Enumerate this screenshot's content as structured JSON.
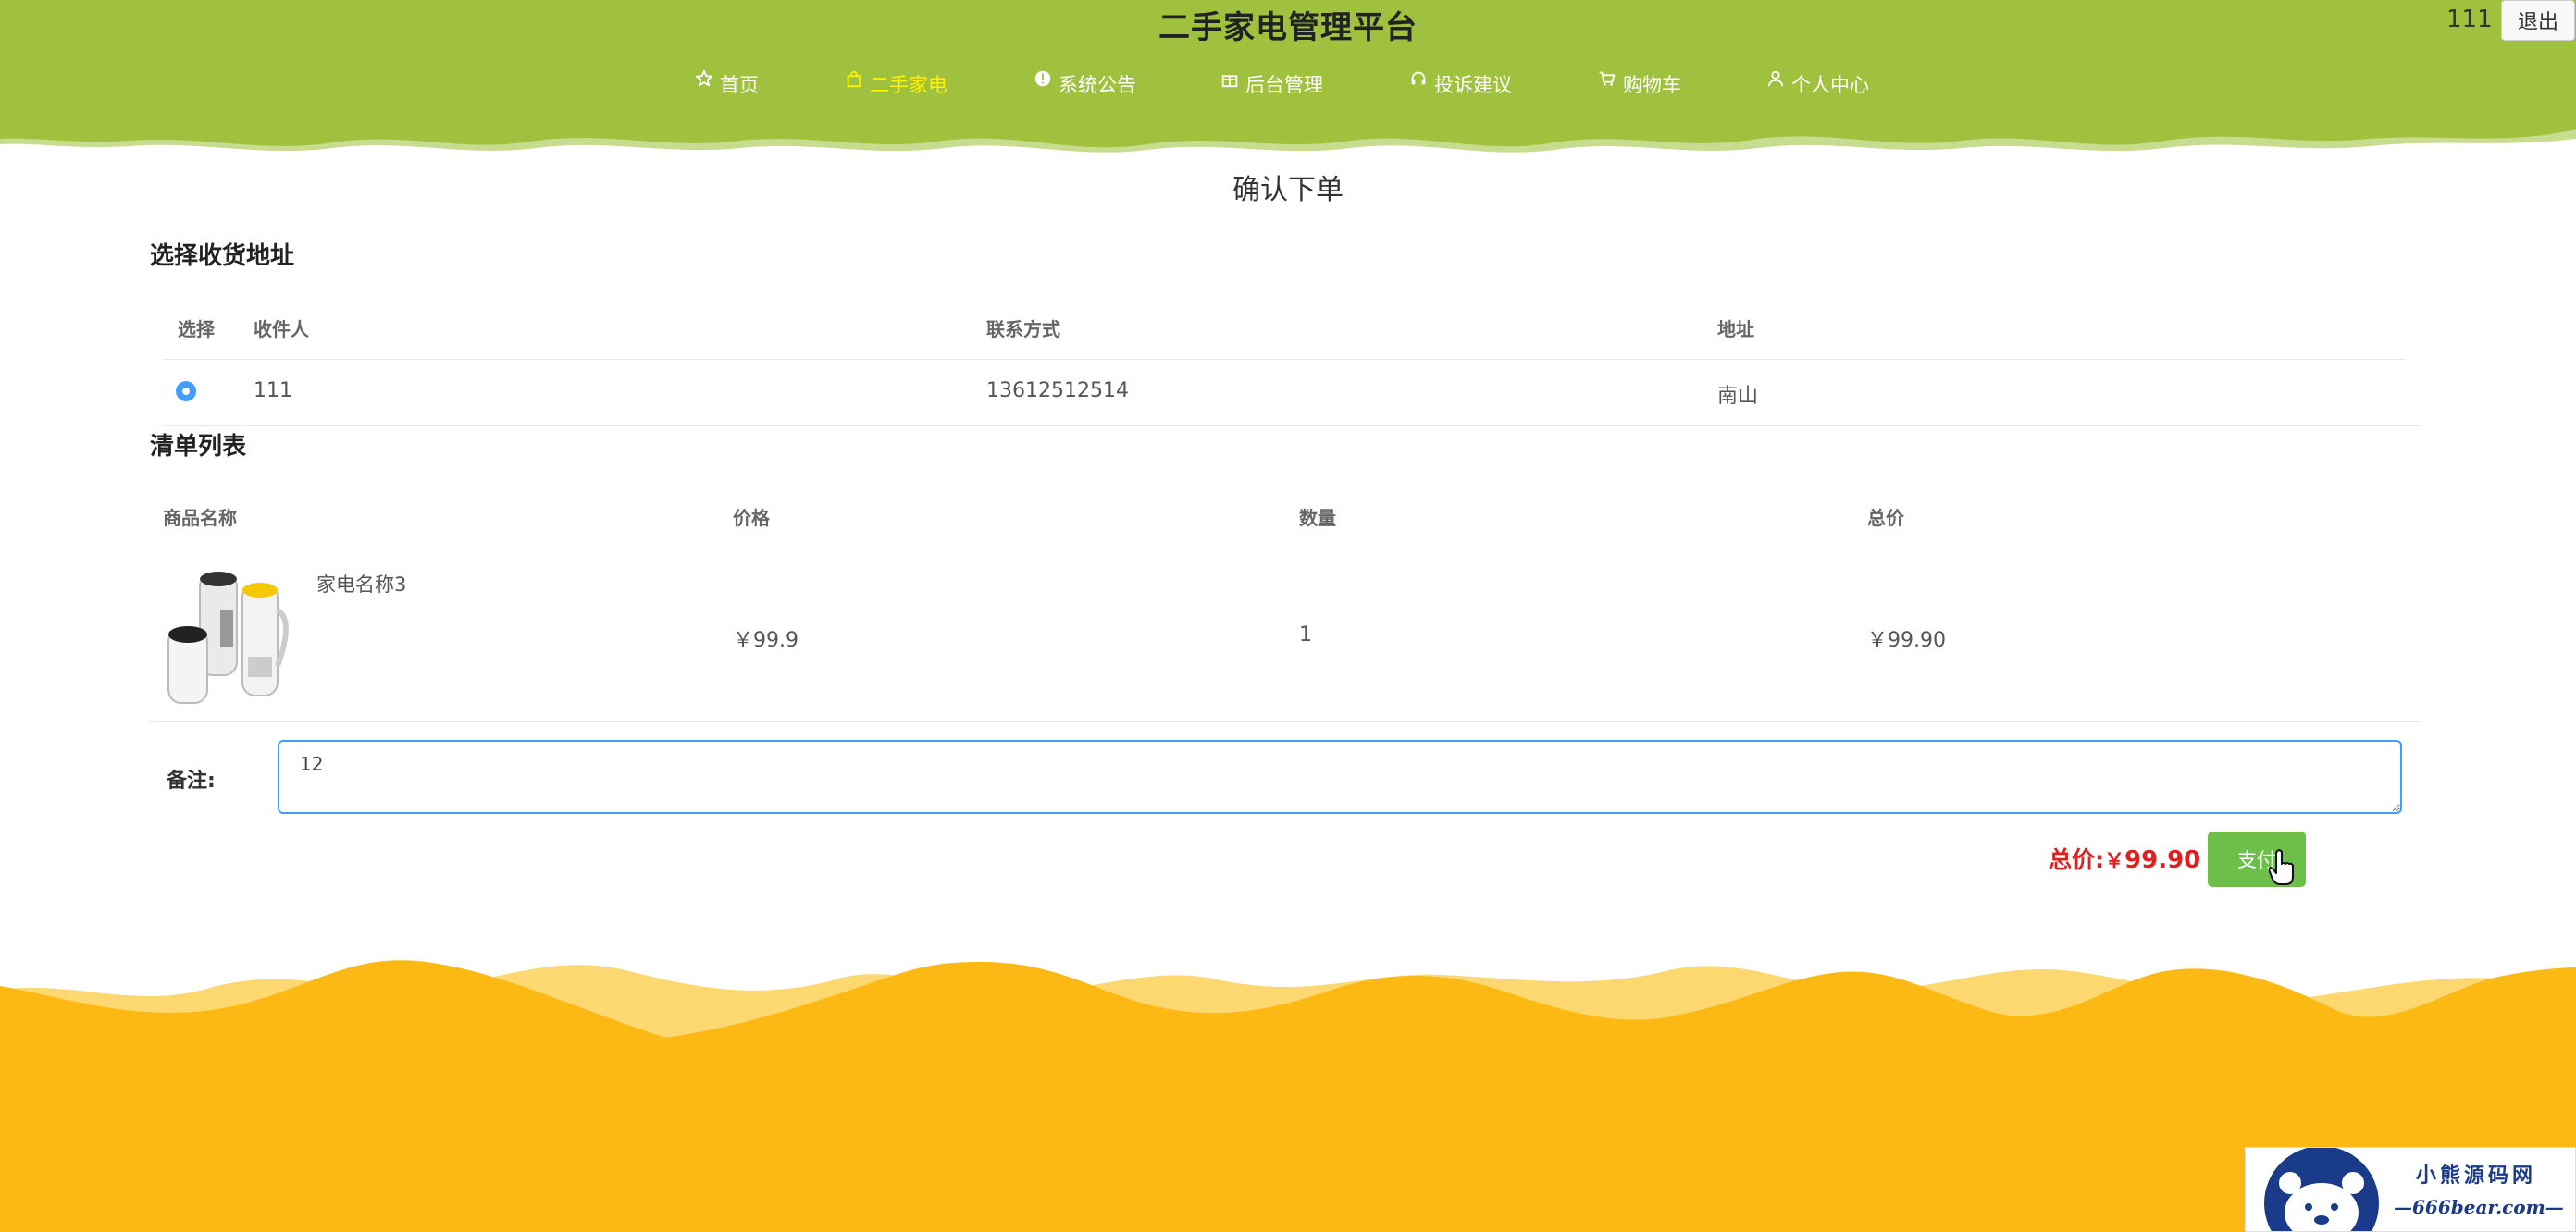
{
  "header": {
    "site_title": "二手家电管理平台",
    "user_name": "111",
    "logout_label": "退出",
    "bg_color": "#a0c13e",
    "nav": [
      {
        "label": "首页",
        "icon": "star-icon",
        "active": false
      },
      {
        "label": "二手家电",
        "icon": "shopping-bag-icon",
        "active": true
      },
      {
        "label": "系统公告",
        "icon": "info-icon",
        "active": false
      },
      {
        "label": "后台管理",
        "icon": "gift-icon",
        "active": false
      },
      {
        "label": "投诉建议",
        "icon": "headset-icon",
        "active": false
      },
      {
        "label": "购物车",
        "icon": "cart-icon",
        "active": false
      },
      {
        "label": "个人中心",
        "icon": "user-icon",
        "active": false
      }
    ]
  },
  "page_heading": "确认下单",
  "address_section": {
    "title": "选择收货地址",
    "columns": [
      "选择",
      "收件人",
      "联系方式",
      "地址"
    ],
    "rows": [
      {
        "selected": true,
        "recipient": "111",
        "phone": "13612512514",
        "address": "南山"
      }
    ]
  },
  "order_section": {
    "title": "清单列表",
    "columns": [
      "商品名称",
      "价格",
      "数量",
      "总价"
    ],
    "items": [
      {
        "name": "家电名称3",
        "image_icon": "appliance-image",
        "price": "￥99.9",
        "quantity": "1",
        "subtotal": "￥99.90"
      }
    ]
  },
  "remark": {
    "label": "备注:",
    "value": "12"
  },
  "total": {
    "label": "总价:",
    "currency": "￥",
    "amount": "99.90"
  },
  "pay_label": "支付",
  "watermark": {
    "line1": "小熊源码网",
    "line2": "—666bear.com—"
  },
  "colors": {
    "accent": "#409eff",
    "pay_button": "#6cc04a",
    "total_price": "#e02020",
    "footer": "#fdb913"
  }
}
